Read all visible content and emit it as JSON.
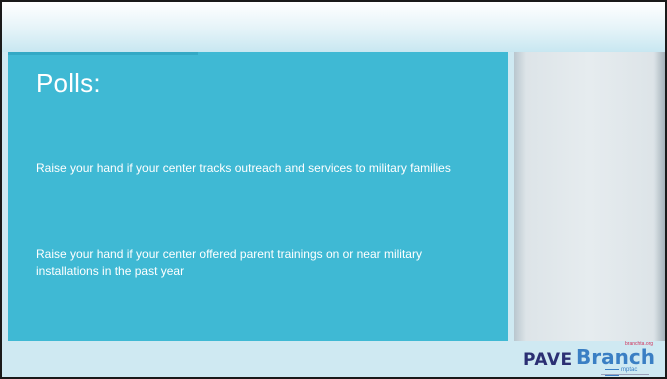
{
  "slide": {
    "title": "Polls:",
    "polls": [
      "Raise your hand if your center  tracks outreach and services to military families",
      "Raise your hand if your center offered parent trainings on or near military installations in the past year"
    ]
  },
  "logo": {
    "pave": "PAVE",
    "branch": "Branch",
    "url": "branchta.org",
    "sub": "mptac"
  },
  "colors": {
    "panel": "#3fb9d4",
    "background": "#cfe9f2",
    "text": "#ffffff",
    "logo_pave": "#2b2f73",
    "logo_branch": "#3a7fc4"
  }
}
